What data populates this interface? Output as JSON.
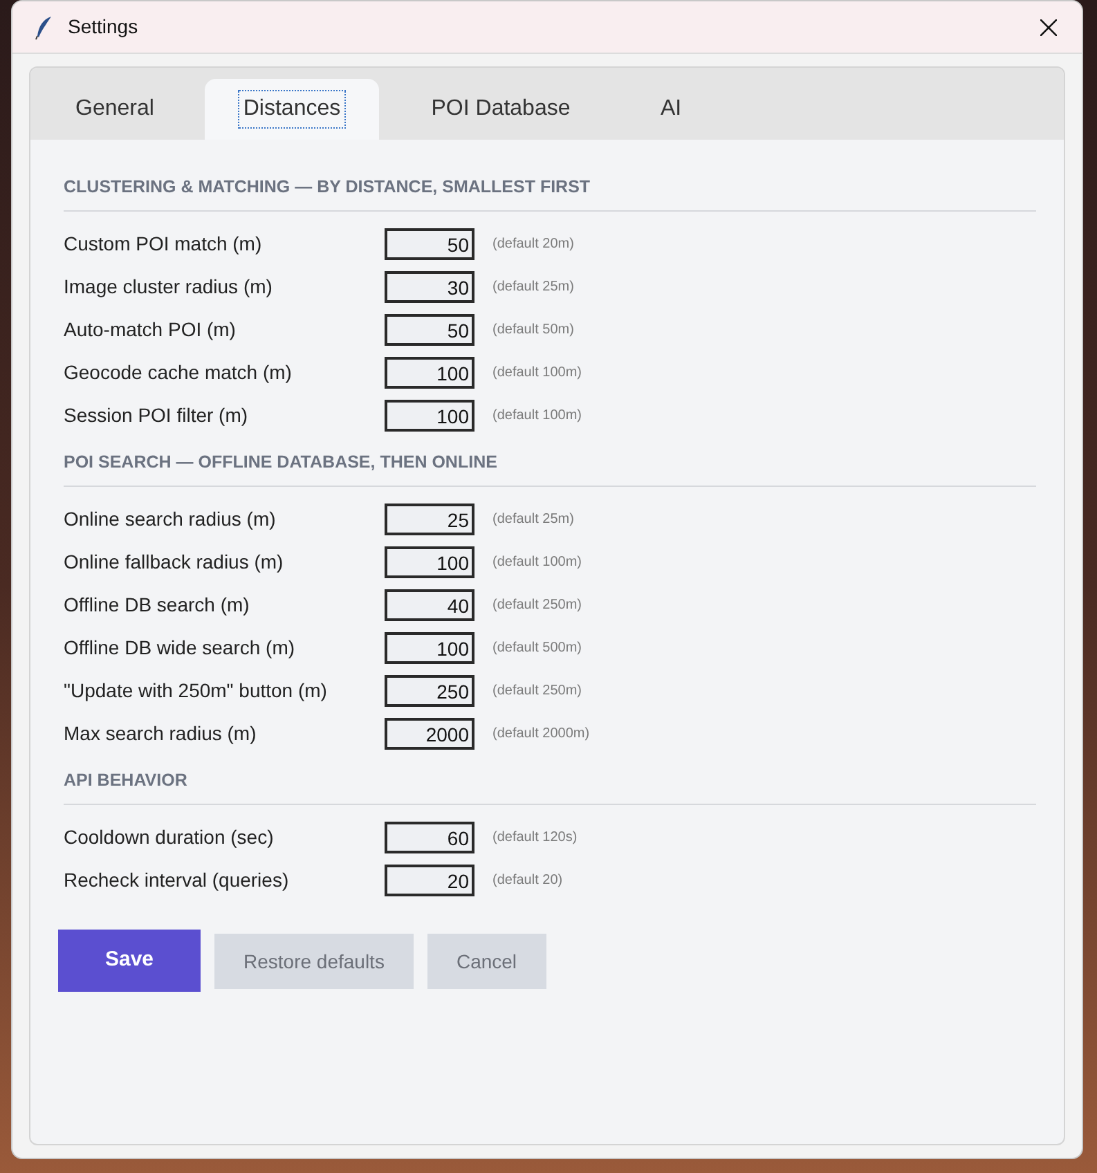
{
  "window": {
    "title": "Settings"
  },
  "tabs": [
    {
      "label": "General",
      "selected": false
    },
    {
      "label": "Distances",
      "selected": true
    },
    {
      "label": "POI Database",
      "selected": false
    },
    {
      "label": "AI",
      "selected": false
    }
  ],
  "sections": [
    {
      "heading": "CLUSTERING & MATCHING — BY DISTANCE, SMALLEST FIRST",
      "fields": [
        {
          "label": "Custom POI match (m)",
          "value": "50",
          "hint": "(default 20m)"
        },
        {
          "label": "Image cluster radius (m)",
          "value": "30",
          "hint": "(default 25m)"
        },
        {
          "label": "Auto-match POI (m)",
          "value": "50",
          "hint": "(default 50m)"
        },
        {
          "label": "Geocode cache match (m)",
          "value": "100",
          "hint": "(default 100m)"
        },
        {
          "label": "Session POI filter (m)",
          "value": "100",
          "hint": "(default 100m)"
        }
      ]
    },
    {
      "heading": "POI SEARCH — OFFLINE DATABASE, THEN ONLINE",
      "fields": [
        {
          "label": "Online search radius (m)",
          "value": "25",
          "hint": "(default 25m)"
        },
        {
          "label": "Online fallback radius (m)",
          "value": "100",
          "hint": "(default 100m)"
        },
        {
          "label": "Offline DB search (m)",
          "value": "40",
          "hint": "(default 250m)"
        },
        {
          "label": "Offline DB wide search (m)",
          "value": "100",
          "hint": "(default 500m)"
        },
        {
          "label": "\"Update with 250m\" button (m)",
          "value": "250",
          "hint": "(default 250m)"
        },
        {
          "label": "Max search radius (m)",
          "value": "2000",
          "hint": "(default 2000m)"
        }
      ]
    },
    {
      "heading": "API BEHAVIOR",
      "fields": [
        {
          "label": "Cooldown duration (sec)",
          "value": "60",
          "hint": "(default 120s)"
        },
        {
          "label": "Recheck interval (queries)",
          "value": "20",
          "hint": "(default 20)"
        }
      ]
    }
  ],
  "buttons": [
    {
      "label": "Save",
      "kind": "primary"
    },
    {
      "label": "Restore defaults",
      "kind": "secondary"
    },
    {
      "label": "Cancel",
      "kind": "secondary"
    }
  ]
}
